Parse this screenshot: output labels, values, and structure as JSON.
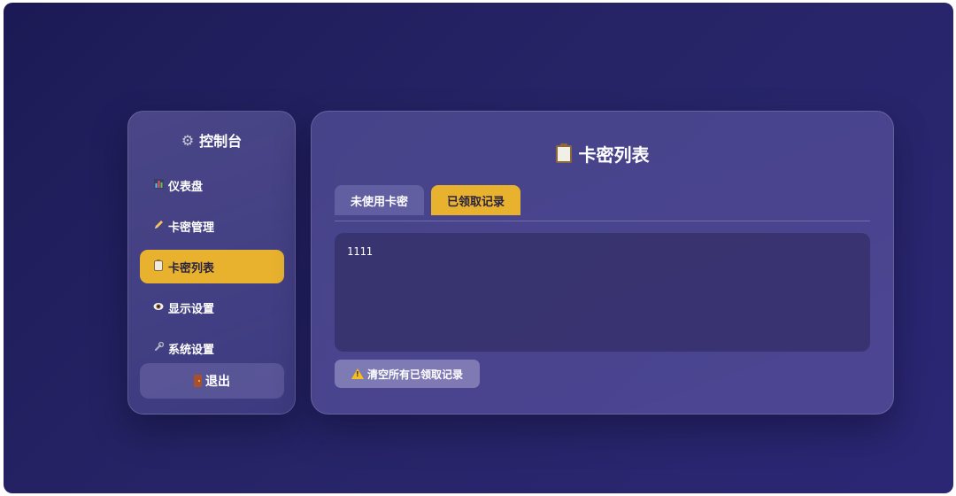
{
  "sidebar": {
    "title": "控制台",
    "title_icon": "gear-icon",
    "items": [
      {
        "label": "仪表盘",
        "icon": "bar-chart-icon",
        "active": false
      },
      {
        "label": "卡密管理",
        "icon": "pencil-icon",
        "active": false
      },
      {
        "label": "卡密列表",
        "icon": "clipboard-icon",
        "active": true
      },
      {
        "label": "显示设置",
        "icon": "eye-icon",
        "active": false
      },
      {
        "label": "系统设置",
        "icon": "wrench-icon",
        "active": false
      }
    ],
    "logout_label": "退出",
    "logout_icon": "door-icon"
  },
  "main": {
    "title": "卡密列表",
    "title_icon": "clipboard-icon",
    "tabs": [
      {
        "label": "未使用卡密",
        "active": false
      },
      {
        "label": "已领取记录",
        "active": true
      }
    ],
    "records_text": "1111",
    "clear_button_label": "清空所有已领取记录",
    "clear_button_icon": "warning-icon"
  },
  "colors": {
    "accent": "#e8b22f",
    "background": "#262466",
    "panel": "#504c94"
  }
}
